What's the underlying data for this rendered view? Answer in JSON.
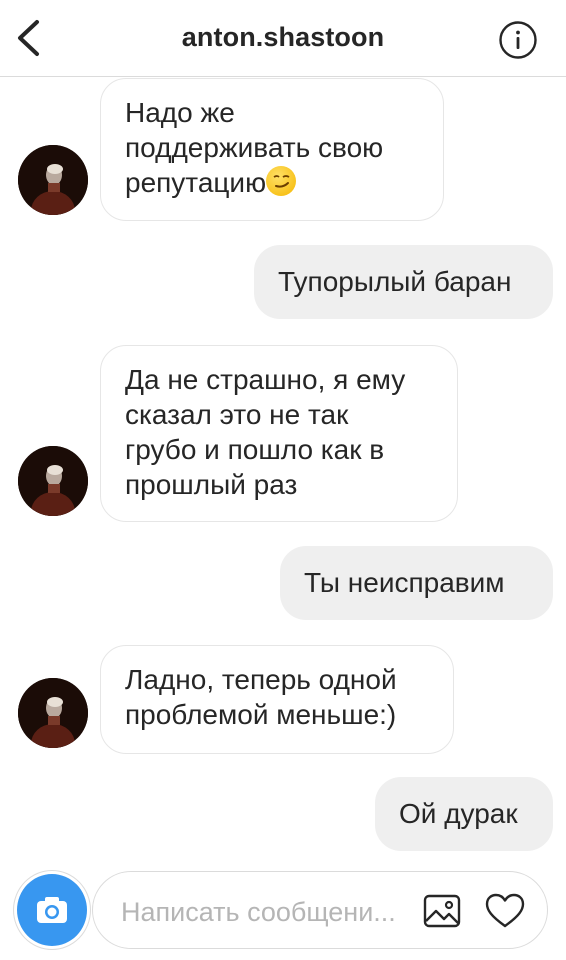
{
  "header": {
    "title": "anton.shastoon",
    "back_icon": "chevron-left-icon",
    "info_icon": "info-icon"
  },
  "messages": [
    {
      "direction": "incoming",
      "lines": [
        "Надо же",
        "поддерживать свою",
        "репутацию"
      ],
      "emoji": "smirking-face-emoji"
    },
    {
      "direction": "outgoing",
      "text": "Тупорылый баран"
    },
    {
      "direction": "incoming",
      "lines": [
        "Да не страшно, я ему",
        "сказал это не так",
        "грубо и пошло как в",
        "прошлый раз"
      ]
    },
    {
      "direction": "outgoing",
      "text": "Ты неисправим"
    },
    {
      "direction": "incoming",
      "lines": [
        "Ладно, теперь одной",
        "проблемой меньше:)"
      ]
    },
    {
      "direction": "outgoing",
      "text": "Ой дурак"
    }
  ],
  "composer": {
    "placeholder": "Написать сообщени...",
    "value": "",
    "camera_icon": "camera-icon",
    "gallery_icon": "image-icon",
    "like_icon": "heart-icon"
  },
  "colors": {
    "accent": "#3897f0",
    "outgoing_bubble": "#efefef",
    "incoming_border": "#e6e6e6",
    "text": "#262626",
    "placeholder": "#b5b5b5"
  }
}
